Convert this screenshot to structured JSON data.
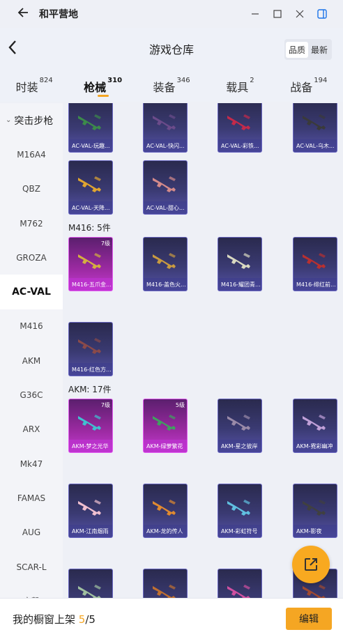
{
  "window": {
    "title": "和平营地"
  },
  "header": {
    "title": "游戏仓库",
    "sort_options": [
      "品质",
      "最新"
    ],
    "active_sort": 0
  },
  "tabs": [
    {
      "label": "时装",
      "count": "824"
    },
    {
      "label": "枪械",
      "count": "310",
      "active": true
    },
    {
      "label": "装备",
      "count": "346"
    },
    {
      "label": "载具",
      "count": "2"
    },
    {
      "label": "战备",
      "count": "194"
    }
  ],
  "sidenav": {
    "group": "突击步枪",
    "items": [
      "M16A4",
      "QBZ",
      "M762",
      "GROZA",
      "AC-VAL",
      "M416",
      "AKM",
      "G36C",
      "ARX",
      "Mk47",
      "FAMAS",
      "AUG",
      "SCAR-L",
      "突撃"
    ],
    "active": "AC-VAL"
  },
  "sections": [
    {
      "title": "",
      "items": [
        {
          "name": "AC-VAL-玩趣...",
          "gun_color": "#3c8a4a"
        },
        {
          "name": "AC-VAL-快闪...",
          "gun_color": "#6b4b8a"
        },
        {
          "name": "AC-VAL-彩铁...",
          "gun_color": "#c42a4a"
        },
        {
          "name": "AC-VAL-乌木...",
          "gun_color": "#3a3a3a"
        },
        {
          "name": "AC-VAL-天降...",
          "gun_color": "#e0a530"
        },
        {
          "name": "AC-VAL-甜心...",
          "gun_color": "#d48a8a"
        }
      ]
    },
    {
      "title": "M416: 5件",
      "items": [
        {
          "name": "M416-五爪金...",
          "grade": "7级",
          "purple": true,
          "gun_color": "#d4b040"
        },
        {
          "name": "M416-盖色火...",
          "gun_color": "#c89a40"
        },
        {
          "name": "M416-耀团青...",
          "gun_color": "#d8d8c0"
        },
        {
          "name": "M416-绯红前...",
          "gun_color": "#b83030"
        },
        {
          "name": "M416-红色方...",
          "gun_color": "#8a4a4a"
        }
      ]
    },
    {
      "title": "AKM: 17件",
      "items": [
        {
          "name": "AKM-梦之光华",
          "grade": "7级",
          "purple": true,
          "gun_color": "#40c0d0"
        },
        {
          "name": "AKM-绿萝繁花",
          "grade": "5级",
          "purple": true,
          "gun_color": "#40a060"
        },
        {
          "name": "AKM-星之彼岸",
          "gun_color": "#9a8aa8"
        },
        {
          "name": "AKM-霓彩幽冲",
          "gun_color": "#c0a0d8"
        },
        {
          "name": "AKM-江南烟雨",
          "gun_color": "#f0c0d0"
        },
        {
          "name": "AKM-龙的传人",
          "gun_color": "#e08a30"
        },
        {
          "name": "AKM-彩虹符号",
          "gun_color": "#60c0e0"
        },
        {
          "name": "AKM-影夜",
          "gun_color": "#404040"
        },
        {
          "name": "",
          "gun_color": "#a0c0a0"
        },
        {
          "name": "",
          "gun_color": "#c07030"
        },
        {
          "name": "",
          "gun_color": "#d050a0"
        },
        {
          "name": "",
          "gun_color": "#a04a30"
        }
      ]
    }
  ],
  "footer": {
    "label": "我的橱窗上架",
    "current": "5",
    "total": "/5",
    "edit_label": "编辑"
  },
  "colors": {
    "accent": "#f5a623",
    "card_purple": "#c33bd0",
    "card_blue": "#5552a6"
  }
}
